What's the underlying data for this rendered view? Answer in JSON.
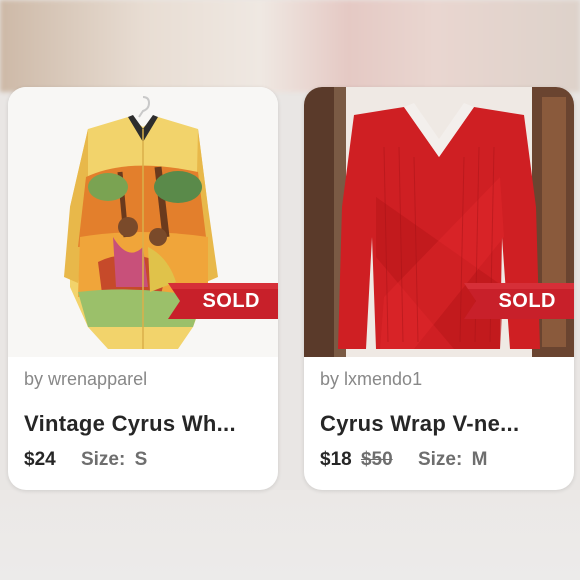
{
  "listings": [
    {
      "seller_prefix": "by",
      "seller": "wrenapparel",
      "title": "Vintage Cyrus Wh...",
      "price": "$24",
      "original_price": "",
      "size_label": "Size:",
      "size": "S",
      "status": "SOLD"
    },
    {
      "seller_prefix": "by",
      "seller": "lxmendo1",
      "title": "Cyrus Wrap V-ne...",
      "price": "$18",
      "original_price": "$50",
      "size_label": "Size:",
      "size": "M",
      "status": "SOLD"
    }
  ],
  "colors": {
    "sold_ribbon": "#c8202a",
    "text_dark": "#262626",
    "text_muted": "#888888"
  }
}
